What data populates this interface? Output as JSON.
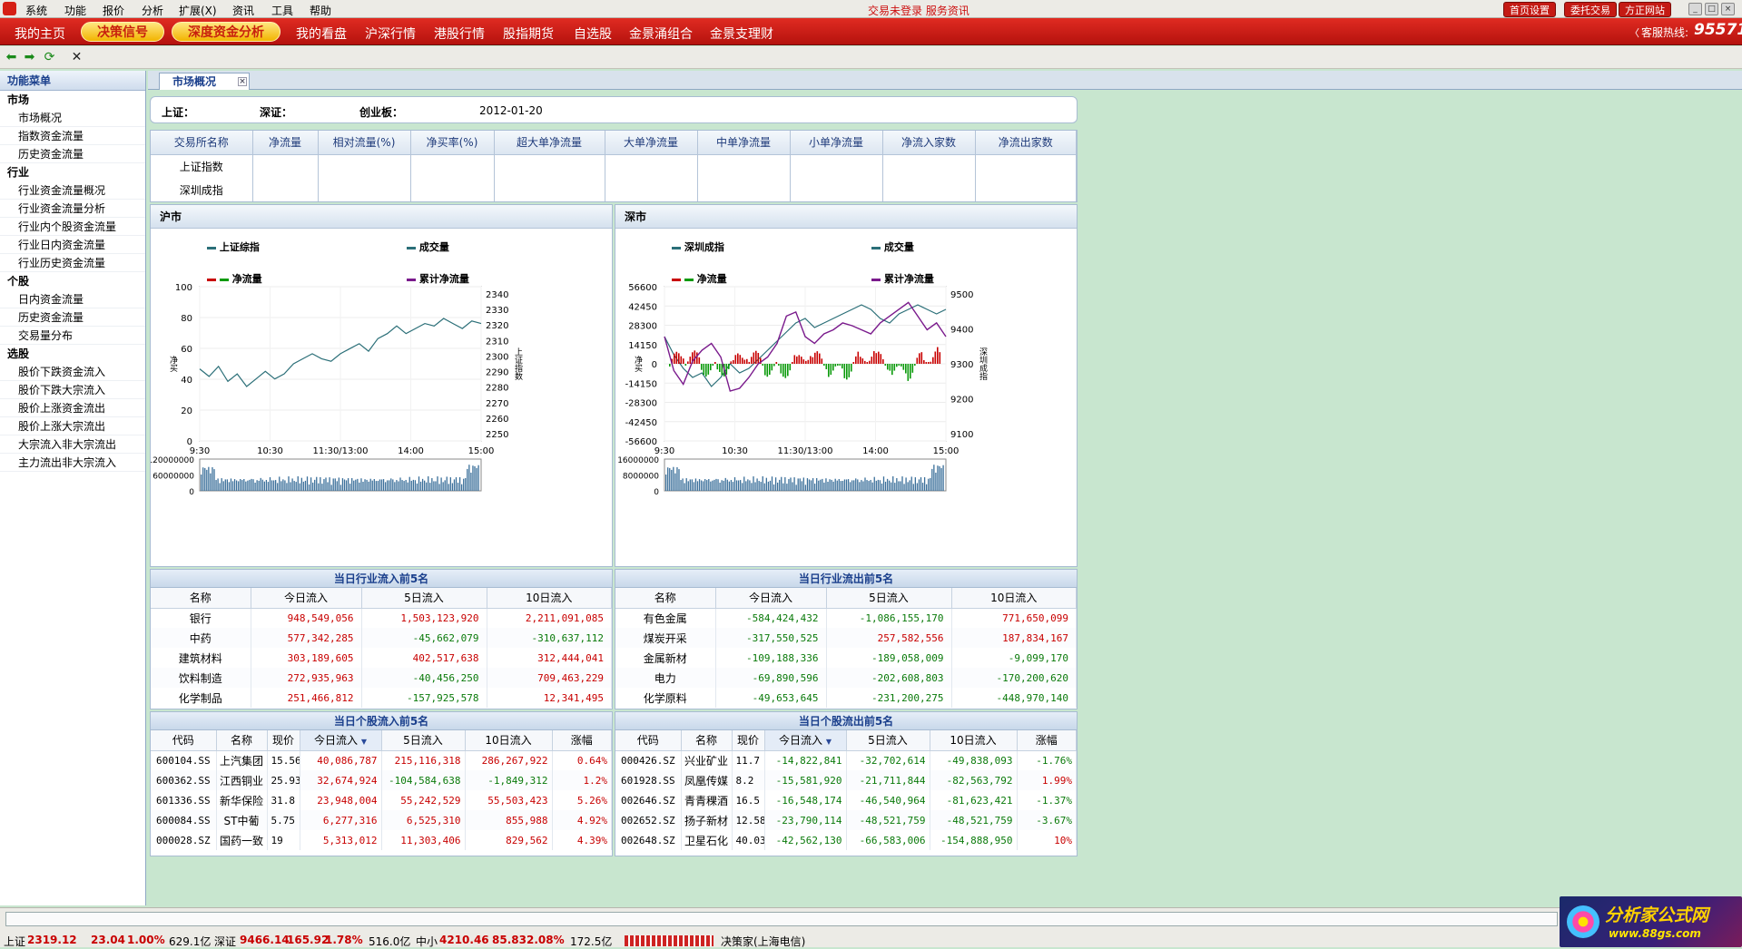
{
  "menubar": {
    "items": [
      "系统",
      "功能",
      "报价",
      "分析",
      "扩展(X)",
      "资讯",
      "工具",
      "帮助"
    ],
    "status": "交易未登录 服务资讯",
    "buttons": [
      "首页设置",
      "委托交易",
      "方正网站"
    ]
  },
  "navbar": {
    "items": [
      "我的主页",
      "我的看盘",
      "沪深行情",
      "港股行情",
      "股指期货",
      "自选股",
      "金景涌组合",
      "金景支理财"
    ],
    "pills": [
      "决策信号",
      "深度资金分析"
    ],
    "hotline_label": "客服热线:",
    "hotline_number": "95571"
  },
  "sidebar": {
    "title": "功能菜单",
    "groups": [
      {
        "name": "市场",
        "items": [
          "市场概况",
          "指数资金流量",
          "历史资金流量"
        ]
      },
      {
        "name": "行业",
        "items": [
          "行业资金流量概况",
          "行业资金流量分析",
          "行业内个股资金流量",
          "行业日内资金流量",
          "行业历史资金流量"
        ]
      },
      {
        "name": "个股",
        "items": [
          "日内资金流量",
          "历史资金流量",
          "交易量分布"
        ]
      },
      {
        "name": "选股",
        "items": [
          "股价下跌资金流入",
          "股价下跌大宗流入",
          "股价上涨资金流出",
          "股价上涨大宗流出",
          "大宗流入非大宗流出",
          "主力流出非大宗流入"
        ]
      }
    ]
  },
  "tab": {
    "label": "市场概况"
  },
  "topinfo": {
    "sh_label": "上证：",
    "sz_label": "深证：",
    "cy_label": "创业板：",
    "date": "2012-01-20"
  },
  "summary": {
    "headers": [
      "交易所名称",
      "净流量",
      "相对流量(%)",
      "净买率(%)",
      "超大单净流量",
      "大单净流量",
      "中单净流量",
      "小单净流量",
      "净流入家数",
      "净流出家数"
    ],
    "rows": [
      "上证指数",
      "深圳成指"
    ]
  },
  "charts": {
    "sh": {
      "title": "沪市",
      "legend": [
        "上证综指",
        "成交量",
        "净流量",
        "累计净流量"
      ],
      "yleft": [
        "100",
        "80",
        "60",
        "40",
        "20",
        "0"
      ],
      "yright": [
        "2340",
        "2330",
        "2320",
        "2310",
        "2300",
        "2290",
        "2280",
        "2270",
        "2260",
        "2250"
      ],
      "ylabel_left": "净买",
      "ylabel_right": "上证指数",
      "xticks": [
        "9:30",
        "10:30",
        "11:30/13:00",
        "14:00",
        "15:00"
      ],
      "vol_ticks": [
        "120000000",
        "60000000",
        "0"
      ]
    },
    "sz": {
      "title": "深市",
      "legend": [
        "深圳成指",
        "成交量",
        "净流量",
        "累计净流量"
      ],
      "yleft": [
        "56600",
        "42450",
        "28300",
        "14150",
        "0",
        "-14150",
        "-28300",
        "-42450",
        "-56600"
      ],
      "yright": [
        "9500",
        "9400",
        "9300",
        "9200",
        "9100"
      ],
      "ylabel_left": "净买",
      "ylabel_right": "深圳成指",
      "xticks": [
        "9:30",
        "10:30",
        "11:30/13:00",
        "14:00",
        "15:00"
      ],
      "vol_ticks": [
        "16000000",
        "8000000",
        "0"
      ]
    }
  },
  "chart_data": [
    {
      "type": "line",
      "title": "沪市",
      "series": [
        {
          "name": "上证综指",
          "values": [
            2301,
            2298,
            2302,
            2296,
            2299,
            2294,
            2297,
            2300,
            2297,
            2299,
            2303,
            2305,
            2307,
            2305,
            2304,
            2307,
            2309,
            2311,
            2308,
            2313,
            2315,
            2318,
            2315,
            2317,
            2319,
            2318,
            2321,
            2319,
            2317,
            2320,
            2319
          ]
        }
      ],
      "ylim": [
        2250,
        2340
      ]
    },
    {
      "type": "line",
      "title": "深市",
      "series": [
        {
          "name": "深圳成指",
          "values": [
            9380,
            9340,
            9310,
            9290,
            9300,
            9270,
            9290,
            9320,
            9300,
            9310,
            9330,
            9350,
            9370,
            9390,
            9410,
            9420,
            9400,
            9410,
            9420,
            9430,
            9440,
            9450,
            9440,
            9420,
            9410,
            9430,
            9440,
            9450,
            9440,
            9430,
            9440
          ]
        },
        {
          "name": "累计净流量",
          "values": [
            20000,
            -5000,
            -15000,
            2000,
            10000,
            15000,
            5000,
            -20000,
            -18000,
            -10000,
            0,
            5000,
            15000,
            35000,
            38000,
            20000,
            15000,
            22000,
            25000,
            30000,
            28000,
            25000,
            22000,
            30000,
            35000,
            40000,
            45000,
            35000,
            25000,
            30000,
            20000
          ]
        }
      ],
      "ylim": [
        -56600,
        56600
      ]
    }
  ],
  "industry_in": {
    "title": "当日行业流入前5名",
    "headers": [
      "名称",
      "今日流入",
      "5日流入",
      "10日流入"
    ],
    "rows": [
      [
        "银行",
        "948,549,056",
        "1,503,123,920",
        "2,211,091,085"
      ],
      [
        "中药",
        "577,342,285",
        "-45,662,079",
        "-310,637,112"
      ],
      [
        "建筑材料",
        "303,189,605",
        "402,517,638",
        "312,444,041"
      ],
      [
        "饮料制造",
        "272,935,963",
        "-40,456,250",
        "709,463,229"
      ],
      [
        "化学制品",
        "251,466,812",
        "-157,925,578",
        "12,341,495"
      ]
    ]
  },
  "industry_out": {
    "title": "当日行业流出前5名",
    "headers": [
      "名称",
      "今日流入",
      "5日流入",
      "10日流入"
    ],
    "rows": [
      [
        "有色金属",
        "-584,424,432",
        "-1,086,155,170",
        "771,650,099"
      ],
      [
        "煤炭开采",
        "-317,550,525",
        "257,582,556",
        "187,834,167"
      ],
      [
        "金属新材",
        "-109,188,336",
        "-189,058,009",
        "-9,099,170"
      ],
      [
        "电力",
        "-69,890,596",
        "-202,608,803",
        "-170,200,620"
      ],
      [
        "化学原料",
        "-49,653,645",
        "-231,200,275",
        "-448,970,140"
      ]
    ]
  },
  "stock_in": {
    "title": "当日个股流入前5名",
    "headers": [
      "代码",
      "名称",
      "现价",
      "今日流入",
      "5日流入",
      "10日流入",
      "涨幅"
    ],
    "rows": [
      [
        "600104.SS",
        "上汽集团",
        "15.56",
        "40,086,787",
        "215,116,318",
        "286,267,922",
        "0.64%"
      ],
      [
        "600362.SS",
        "江西铜业",
        "25.93",
        "32,674,924",
        "-104,584,638",
        "-1,849,312",
        "1.2%"
      ],
      [
        "601336.SS",
        "新华保险",
        "31.8",
        "23,948,004",
        "55,242,529",
        "55,503,423",
        "5.26%"
      ],
      [
        "600084.SS",
        "ST中葡",
        "5.75",
        "6,277,316",
        "6,525,310",
        "855,988",
        "4.92%"
      ],
      [
        "000028.SZ",
        "国药一致",
        "19",
        "5,313,012",
        "11,303,406",
        "829,562",
        "4.39%"
      ]
    ]
  },
  "stock_out": {
    "title": "当日个股流出前5名",
    "headers": [
      "代码",
      "名称",
      "现价",
      "今日流入",
      "5日流入",
      "10日流入",
      "涨幅"
    ],
    "rows": [
      [
        "000426.SZ",
        "兴业矿业",
        "11.7",
        "-14,822,841",
        "-32,702,614",
        "-49,838,093",
        "-1.76%"
      ],
      [
        "601928.SS",
        "凤凰传媒",
        "8.2",
        "-15,581,920",
        "-21,711,844",
        "-82,563,792",
        "1.99%"
      ],
      [
        "002646.SZ",
        "青青稞酒",
        "16.5",
        "-16,548,174",
        "-46,540,964",
        "-81,623,421",
        "-1.37%"
      ],
      [
        "002652.SZ",
        "扬子新材",
        "12.58",
        "-23,790,114",
        "-48,521,759",
        "-48,521,759",
        "-3.67%"
      ],
      [
        "002648.SZ",
        "卫星石化",
        "40.03",
        "-42,562,130",
        "-66,583,006",
        "-154,888,950",
        "10%"
      ]
    ]
  },
  "statusbar": {
    "sh": "上证",
    "sh_val": "2319.12",
    "sh_chg": "23.04",
    "sh_pct": "1.00%",
    "sh_amt": "629.1亿",
    "sz": "深证",
    "sz_val": "9466.14",
    "sz_chg": "165.92",
    "sz_pct": "1.78%",
    "sz_amt": "516.0亿",
    "zx": "中小",
    "zx_val": "4210.46",
    "zx_chg": "85.83",
    "zx_pct": "2.08%",
    "zx_amt": "172.5亿",
    "source": "决策家(上海电信)"
  },
  "brand": {
    "name": "分析家公式网",
    "url": "www.88gs.com"
  },
  "colors": {
    "up": "#c80000",
    "down": "#0a7a0a",
    "index_line": "#2b6f78",
    "cum_line": "#7a1a8c",
    "volume": "#3a6f9a"
  }
}
